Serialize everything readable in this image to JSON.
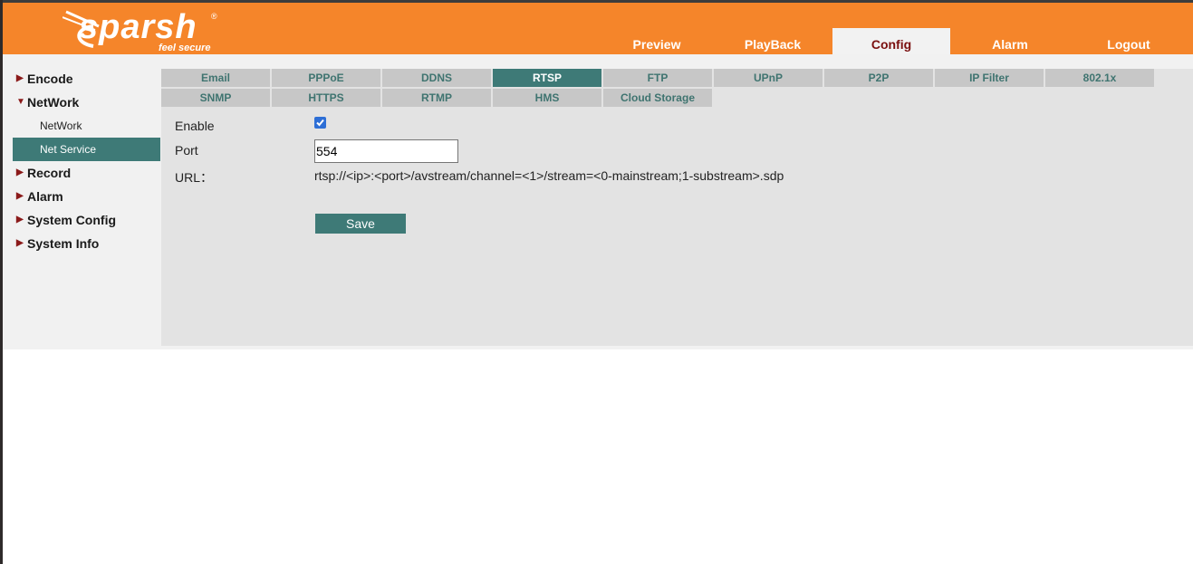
{
  "brand": {
    "name": "sparsh",
    "tagline": "feel secure",
    "registered": "®"
  },
  "nav": {
    "items": [
      {
        "label": "Preview",
        "active": false
      },
      {
        "label": "PlayBack",
        "active": false
      },
      {
        "label": "Config",
        "active": true
      },
      {
        "label": "Alarm",
        "active": false
      },
      {
        "label": "Logout",
        "active": false
      }
    ]
  },
  "sidebar": {
    "encode": "Encode",
    "network": "NetWork",
    "network_sub": "NetWork",
    "net_service": "Net Service",
    "record": "Record",
    "alarm": "Alarm",
    "system_config": "System Config",
    "system_info": "System Info",
    "expanded_icon": "triangle-down-icon",
    "collapsed_icon": "triangle-right-icon"
  },
  "tabs": {
    "row1": [
      "Email",
      "PPPoE",
      "DDNS",
      "RTSP",
      "FTP",
      "UPnP",
      "P2P",
      "IP Filter",
      "802.1x"
    ],
    "row2": [
      "SNMP",
      "HTTPS",
      "RTMP",
      "HMS",
      "Cloud Storage"
    ],
    "active": "RTSP"
  },
  "form": {
    "enable_label": "Enable",
    "enable_checked": true,
    "port_label": "Port",
    "port_value": "554",
    "url_label": "URL：",
    "url_value": "rtsp://<ip>:<port>/avstream/channel=<1>/stream=<0-mainstream;1-substream>.sdp",
    "save_label": "Save"
  },
  "colors": {
    "header": "#f5852a",
    "accent": "#3e7a77",
    "active_nav_text": "#7a1010"
  }
}
